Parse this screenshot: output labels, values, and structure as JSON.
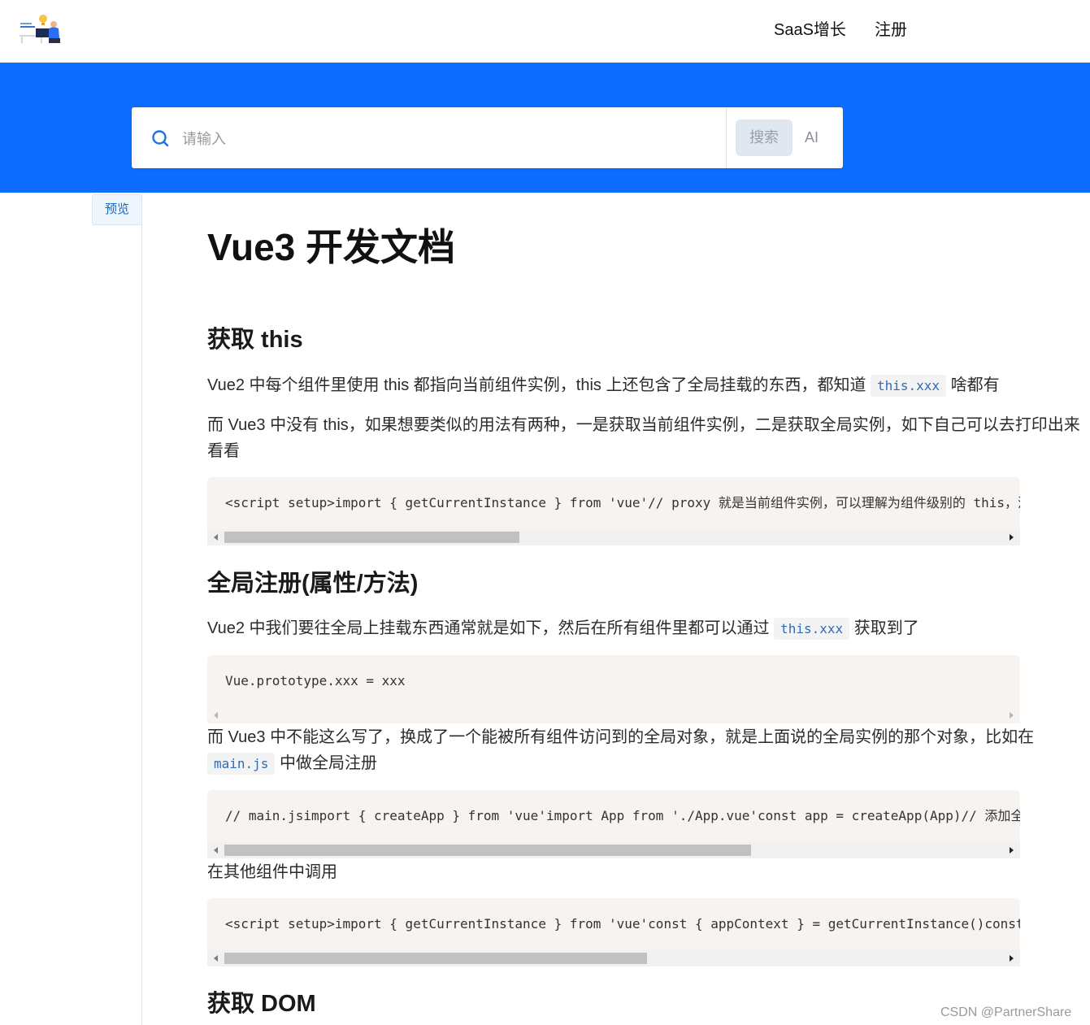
{
  "nav": {
    "logo": "site-logo",
    "links": [
      "SaaS增长",
      "注册"
    ]
  },
  "search": {
    "placeholder": "请输入",
    "button": "搜索",
    "ai": "AI"
  },
  "sidebar": {
    "preview_tab": "预览"
  },
  "article": {
    "title": "Vue3 开发文档",
    "sections": [
      {
        "heading": "获取 this",
        "p1": {
          "before": "Vue2 中每个组件里使用 this 都指向当前组件实例，this 上还包含了全局挂载的东西，都知道 ",
          "code": "this.xxx",
          "after": " 啥都有"
        },
        "p2": "而 Vue3 中没有 this，如果想要类似的用法有两种，一是获取当前组件实例，二是获取全局实例，如下自己可以去打印出来看看",
        "code1": "<script setup>import { getCurrentInstance } from 'vue'// proxy 就是当前组件实例，可以理解为组件级别的 this，没有全局的、路由、状态管理之类的const { proxy, appContext } = getCurrentInstance()"
      },
      {
        "heading": "全局注册(属性/方法)",
        "p1": {
          "before": "Vue2 中我们要往全局上挂载东西通常就是如下，然后在所有组件里都可以通过 ",
          "code": "this.xxx",
          "after": " 获取到了"
        },
        "code1": "Vue.prototype.xxx = xxx",
        "p2": {
          "before": "而 Vue3 中不能这么写了，换成了一个能被所有组件访问到的全局对象，就是上面说的全局实例的那个对象，比如在 ",
          "code": "main.js",
          "after": " 中做全局注册"
        },
        "code2": "// main.jsimport { createApp } from 'vue'import App from './App.vue'const app = createApp(App)// 添加全局属性app.config.globalProperties.name = '沐华'",
        "p3": "在其他组件中调用",
        "code3": "<script setup>import { getCurrentInstance } from 'vue'const { appContext } = getCurrentInstance()const global = appContext.config.globalProperties"
      },
      {
        "heading": "获取 DOM"
      }
    ]
  },
  "watermark": "CSDN @PartnerShare",
  "colors": {
    "band": "#0b6cff",
    "inline_code": "#2f6bb6",
    "code_bg": "#f6f3f0"
  },
  "icons": {
    "search": "search-icon"
  }
}
